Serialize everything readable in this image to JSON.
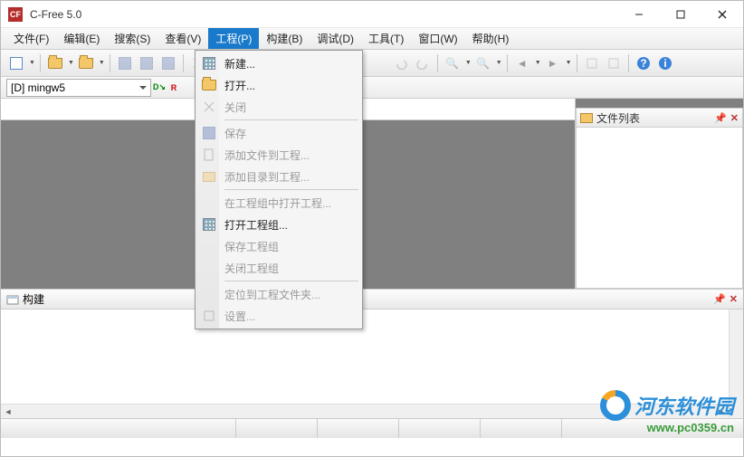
{
  "window": {
    "title": "C-Free 5.0"
  },
  "menubar": {
    "items": [
      {
        "label": "文件(F)",
        "key": "F"
      },
      {
        "label": "编辑(E)",
        "key": "E"
      },
      {
        "label": "搜索(S)",
        "key": "S"
      },
      {
        "label": "查看(V)",
        "key": "V"
      },
      {
        "label": "工程(P)",
        "key": "P",
        "active": true
      },
      {
        "label": "构建(B)",
        "key": "B"
      },
      {
        "label": "调试(D)",
        "key": "D"
      },
      {
        "label": "工具(T)",
        "key": "T"
      },
      {
        "label": "窗口(W)",
        "key": "W"
      },
      {
        "label": "帮助(H)",
        "key": "H"
      }
    ]
  },
  "dropdown": {
    "items": [
      {
        "label": "新建...",
        "icon": "grid",
        "enabled": true
      },
      {
        "label": "打开...",
        "icon": "open",
        "enabled": true
      },
      {
        "label": "关闭",
        "icon": "close",
        "enabled": false
      },
      {
        "sep": true
      },
      {
        "label": "保存",
        "icon": "save",
        "enabled": false
      },
      {
        "label": "添加文件到工程...",
        "icon": "addfile",
        "enabled": false
      },
      {
        "label": "添加目录到工程...",
        "icon": "adddir",
        "enabled": false
      },
      {
        "sep": true
      },
      {
        "label": "在工程组中打开工程...",
        "enabled": false
      },
      {
        "label": "打开工程组...",
        "icon": "grid",
        "enabled": true
      },
      {
        "label": "保存工程组",
        "enabled": false
      },
      {
        "label": "关闭工程组",
        "enabled": false
      },
      {
        "sep": true
      },
      {
        "label": "定位到工程文件夹...",
        "enabled": false
      },
      {
        "label": "设置...",
        "icon": "settings",
        "enabled": false
      }
    ]
  },
  "compiler": {
    "selected": "[D] mingw5"
  },
  "panels": {
    "filelist": {
      "title": "文件列表"
    },
    "build": {
      "title": "构建"
    }
  },
  "watermark": {
    "line1": "河东软件园",
    "line2": "www.pc0359.cn"
  }
}
